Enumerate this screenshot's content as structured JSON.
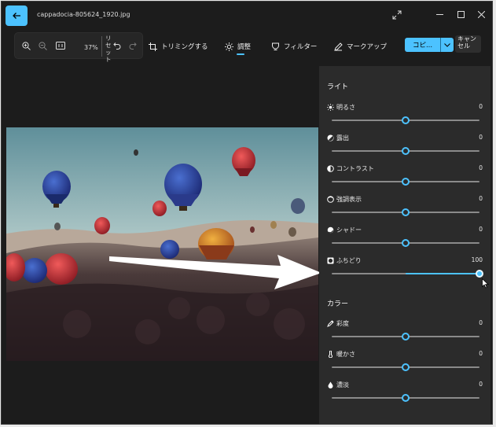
{
  "window": {
    "title": "cappadocia-805624_1920.jpg"
  },
  "toolbar": {
    "zoom_percent": "37%",
    "reset_label": "リセット",
    "crop_label": "トリミングする",
    "adjust_label": "調整",
    "filter_label": "フィルター",
    "markup_label": "マークアップ",
    "copy_label": "コピ...",
    "cancel_label": "キャンセル"
  },
  "panel": {
    "light_heading": "ライト",
    "color_heading": "カラー",
    "light_items": [
      {
        "label": "明るさ",
        "value": "0",
        "level": 0.5,
        "icon": "sun-icon"
      },
      {
        "label": "露出",
        "value": "0",
        "level": 0.5,
        "icon": "exposure-icon"
      },
      {
        "label": "コントラスト",
        "value": "0",
        "level": 0.5,
        "icon": "contrast-icon"
      },
      {
        "label": "強調表示",
        "value": "0",
        "level": 0.5,
        "icon": "highlight-icon"
      },
      {
        "label": "シャドー",
        "value": "0",
        "level": 0.5,
        "icon": "shadow-icon"
      },
      {
        "label": "ふちどり",
        "value": "100",
        "level": 1.0,
        "icon": "vignette-icon"
      }
    ],
    "color_items": [
      {
        "label": "彩度",
        "value": "0",
        "level": 0.5,
        "icon": "eyedropper-icon"
      },
      {
        "label": "暖かさ",
        "value": "0",
        "level": 0.5,
        "icon": "thermometer-icon"
      },
      {
        "label": "濃淡",
        "value": "0",
        "level": 0.5,
        "icon": "drop-icon"
      }
    ]
  },
  "colors": {
    "accent": "#4cc2ff",
    "panel_bg": "#2b2b2b",
    "window_bg": "#1c1c1c"
  }
}
